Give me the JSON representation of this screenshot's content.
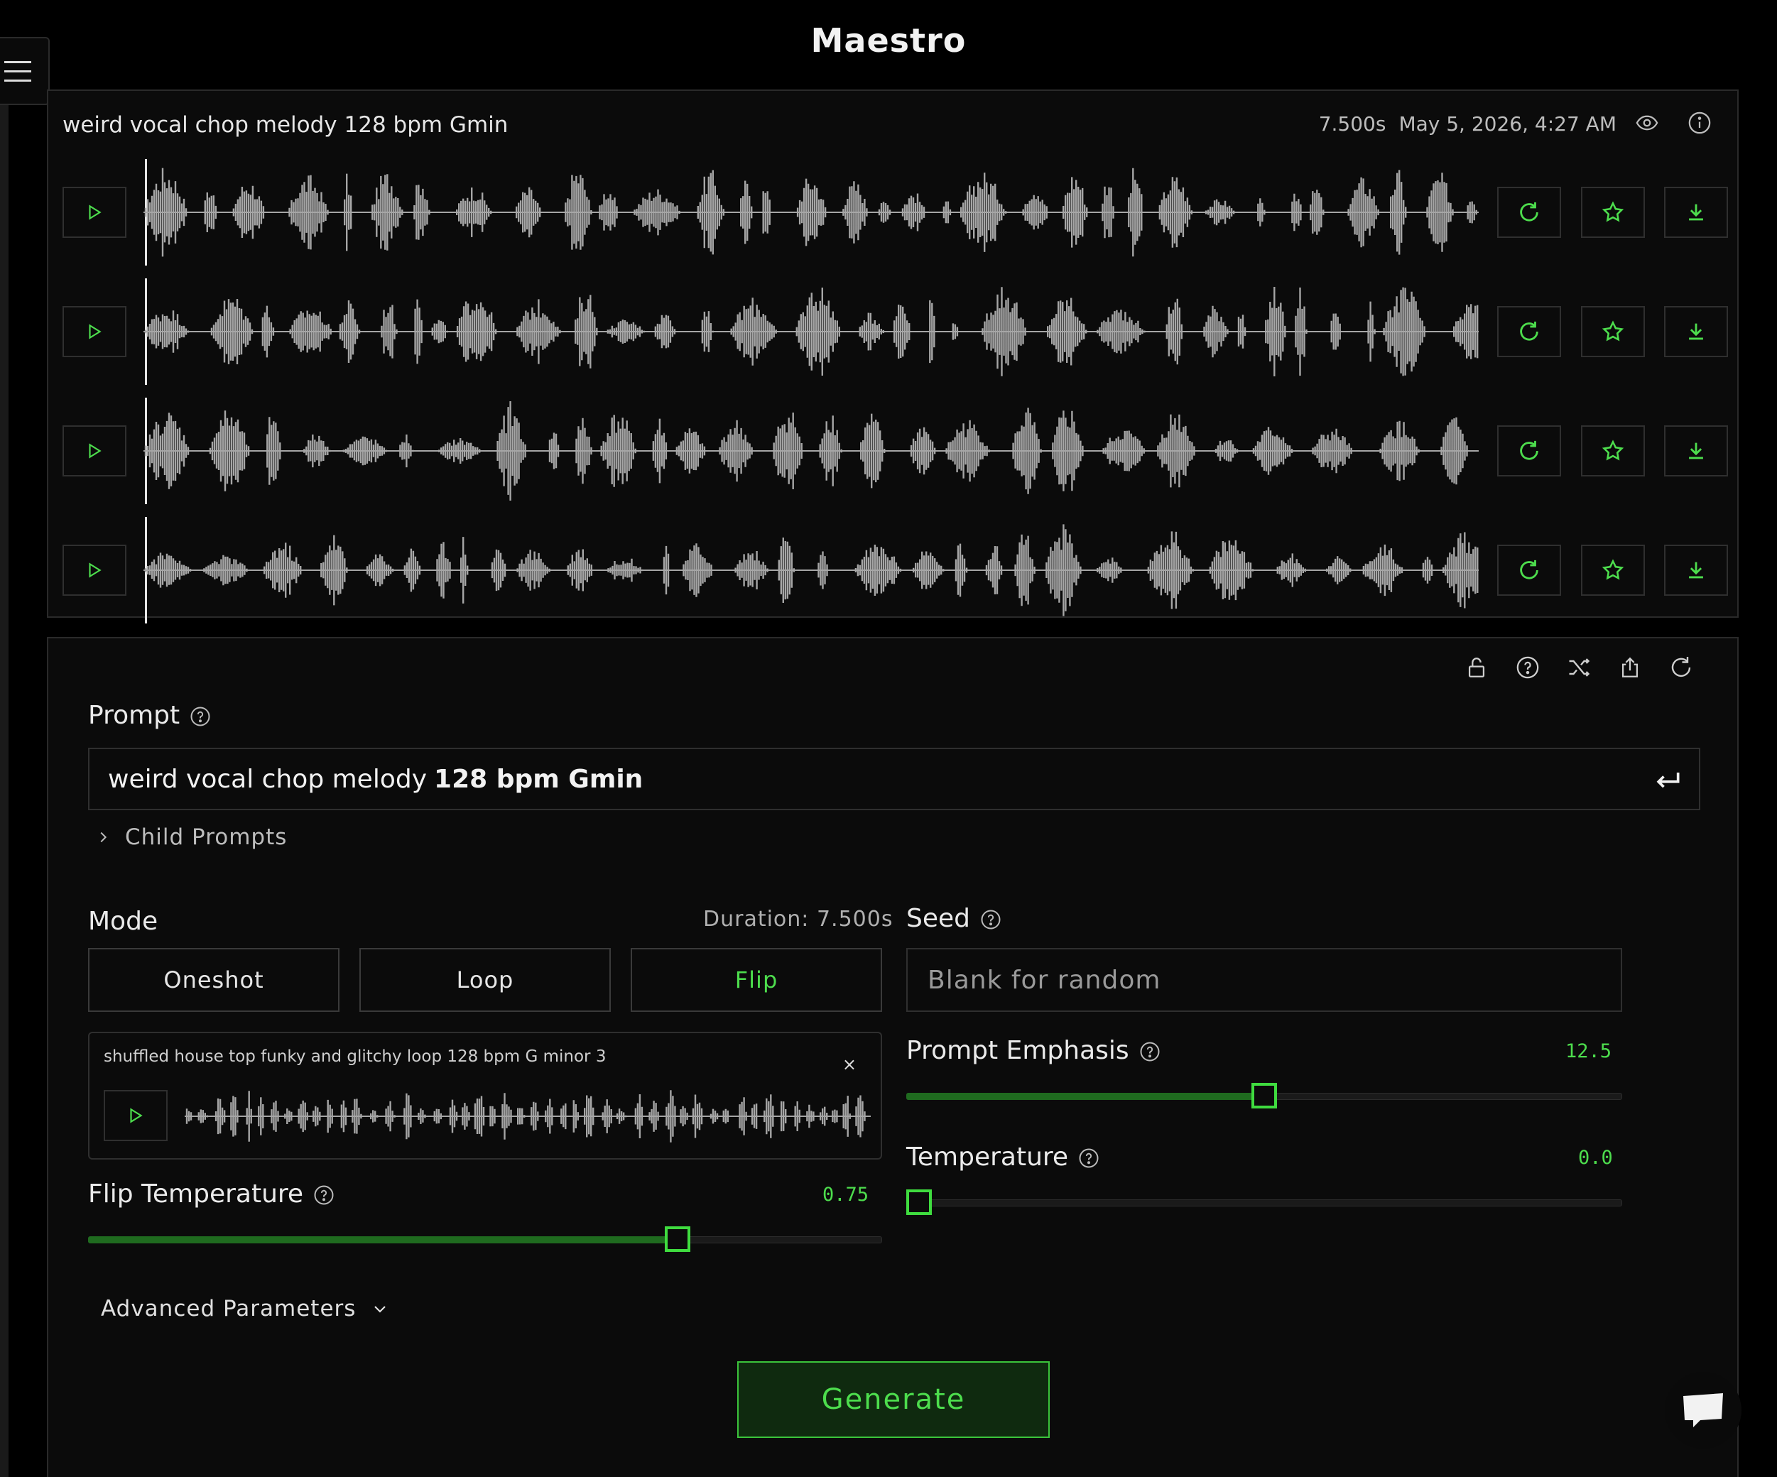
{
  "app": {
    "title": "Maestro"
  },
  "result": {
    "title": "weird vocal chop melody 128 bpm Gmin",
    "duration": "7.500s",
    "timestamp": "May 5, 2026, 4:27 AM",
    "tracks": [
      {
        "id": 1
      },
      {
        "id": 2
      },
      {
        "id": 3
      },
      {
        "id": 4
      }
    ]
  },
  "controls": {
    "prompt": {
      "label": "Prompt",
      "value_plain": "weird vocal chop melody",
      "value_bold": "128 bpm Gmin"
    },
    "child_prompts_label": "Child Prompts",
    "mode": {
      "label": "Mode",
      "duration": "Duration: 7.500s",
      "options": [
        "Oneshot",
        "Loop",
        "Flip"
      ],
      "selected": "Flip"
    },
    "seed": {
      "label": "Seed",
      "placeholder": "Blank for random"
    },
    "flip_source": {
      "title": "shuffled house top funky and glitchy loop 128 bpm G minor 3",
      "close": "×"
    },
    "flip_temperature": {
      "label": "Flip Temperature",
      "value": "0.75",
      "fraction": 0.742
    },
    "prompt_emphasis": {
      "label": "Prompt Emphasis",
      "value": "12.5",
      "fraction": 0.5
    },
    "temperature": {
      "label": "Temperature",
      "value": "0.0",
      "fraction": 0.0
    },
    "advanced_label": "Advanced Parameters",
    "generate_label": "Generate"
  },
  "colors": {
    "accent": "#4ddd4d",
    "accent_dark": "#1f6b1f",
    "waveform": "#a6a6a6",
    "background": "#000000",
    "panel": "#0b0b0b"
  }
}
